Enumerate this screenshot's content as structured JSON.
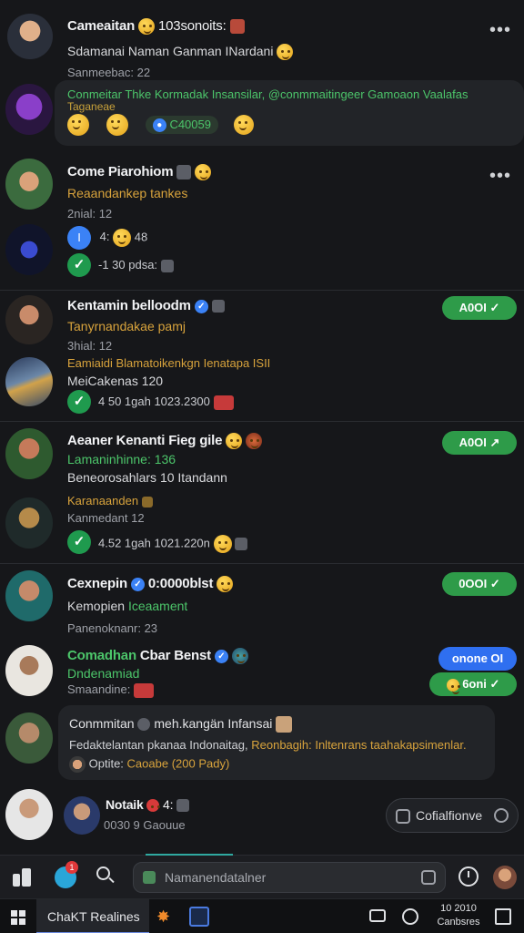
{
  "posts": [
    {
      "author": "Cameaitan",
      "handle": "103sonoits:",
      "body": "Sdamanai Naman Ganman INardani",
      "meta": "Sanmeebac: 22",
      "mentions": "Conmeitar Thke Kormadak Insansilar, @conmmaitingeer Gamoaon Vaalafas",
      "tag": "Taganeae",
      "chip": "C40059"
    },
    {
      "author": "Come Piarohiom",
      "sub": "Reaandankep tankes",
      "meta": "2nial: 12",
      "reactions1": "4:",
      "reactions1b": "48",
      "reactions2": "-1 30  pdsa:"
    },
    {
      "author": "Kentamin belloodm",
      "sub": "Tanyrnandakae pamj",
      "meta": "3hial: 12",
      "mentions": "Eamiaidi  Blamatoikenkgn Ienatapa ISII",
      "sub2": "MeiCakenas 120",
      "stats": "4 50  1gah  1023.2300",
      "pill": "A0OI"
    },
    {
      "author": "Aeaner Kenanti Fieg gile",
      "sub": "Lamaninhinne: 136",
      "sub2": "Beneorosahlars 10 Itandann",
      "tag": "Karanaanden",
      "meta": "Kanmedant 12",
      "stats": "4.52  1gah  1021.220n",
      "pill": "A0OI"
    },
    {
      "author": "Cexnepin",
      "handle": "0:0000blst",
      "sub": "Kemopien",
      "sub_green": "Iceaament",
      "meta": "Panenoknanr: 23",
      "pill": "0OOI"
    },
    {
      "author": "Comadhan",
      "author2": "Cbar Benst",
      "sub": "Dndenamiad",
      "meta": "Smaandine:",
      "pill_blue": "onone OI",
      "pill_green": "6oni"
    },
    {
      "header": "Conmmitan",
      "header2": "meh.kangän Infansai",
      "body1": "Fedaktelantan pkanaa Indonaitag,",
      "body2": "Reonbagih: Inltenrans taahakapsimenlar.",
      "footer": "Optite:",
      "footer2": "Caoabe (200 Pady)"
    },
    {
      "author": "Notaik",
      "meta": "0030 9  Gaouue",
      "reactions": "4:",
      "action": "Cofialfionve"
    }
  ],
  "bottom_bar": {
    "notif_count": "1",
    "search_placeholder": "Namanendatalner"
  },
  "taskbar": {
    "app_label": "ChaKT Realines",
    "time": "10 2010",
    "date": "Canbsres"
  }
}
